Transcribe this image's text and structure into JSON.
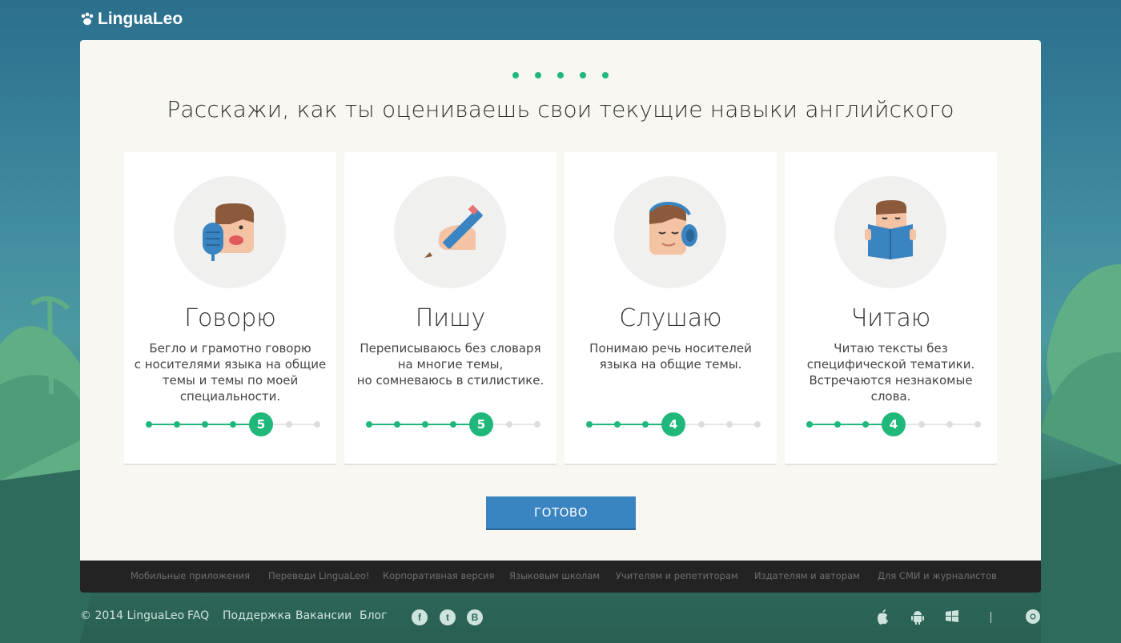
{
  "brand": {
    "name": "LinguaLeo"
  },
  "progress": {
    "total_steps": 5,
    "completed_steps": 5
  },
  "heading": "Расскажи, как ты оцениваешь свои текущие навыки английского",
  "skills": [
    {
      "title": "Говорю",
      "icon": "speaking-icon",
      "desc": [
        "Бегло и грамотно говорю",
        "с носителями языка на общие",
        "темы и темы по моей",
        "специальности."
      ],
      "level": 5,
      "max": 7,
      "level_label": "5"
    },
    {
      "title": "Пишу",
      "icon": "writing-icon",
      "desc": [
        "Переписываюсь без словаря",
        "на многие темы,",
        "но сомневаюсь в стилистике."
      ],
      "level": 5,
      "max": 7,
      "level_label": "5"
    },
    {
      "title": "Слушаю",
      "icon": "listening-icon",
      "desc": [
        "Понимаю речь носителей",
        "языка на общие темы."
      ],
      "level": 4,
      "max": 7,
      "level_label": "4"
    },
    {
      "title": "Читаю",
      "icon": "reading-icon",
      "desc": [
        "Читаю тексты без",
        "специфической тематики.",
        "Встречаются незнакомые",
        "слова."
      ],
      "level": 4,
      "max": 7,
      "level_label": "4"
    }
  ],
  "done_button": "ГОТОВО",
  "footer_links": [
    "Мобильные приложения",
    "Переведи LinguaLeo!",
    "Корпоративная версия",
    "Языковым школам",
    "Учителям и репетиторам",
    "Издателям и авторам",
    "Для СМИ и журналистов"
  ],
  "bottom": {
    "copyright": "© 2014 LinguaLeo",
    "links": [
      "FAQ",
      "Поддержка",
      "Вакансии",
      "Блог"
    ]
  },
  "social": [
    {
      "icon": "facebook-icon",
      "glyph": "f"
    },
    {
      "icon": "twitter-icon",
      "glyph": "t"
    },
    {
      "icon": "vk-icon",
      "glyph": "B"
    }
  ],
  "platforms": [
    "apple-icon",
    "android-icon",
    "windows-icon",
    "chrome-icon"
  ],
  "colors": {
    "accent": "#1fb87a",
    "button": "#3a85c1",
    "panel": "#f8f7f1",
    "footer": "#232323",
    "inactive": "#dddddd"
  }
}
